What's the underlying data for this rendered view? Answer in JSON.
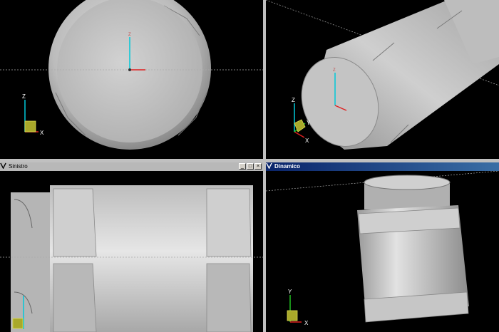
{
  "viewports": {
    "top_left": {
      "name": ""
    },
    "top_right": {
      "name": ""
    },
    "bottom_left": {
      "name": "Sinistro"
    },
    "bottom_right": {
      "name": "Dinamico"
    }
  },
  "axis_labels": {
    "x": "X",
    "y": "Y",
    "z": "Z"
  },
  "window_buttons": {
    "minimize": "_",
    "maximize": "□",
    "close": "×"
  },
  "colors": {
    "x_axis": "#e02020",
    "y_axis": "#20c020",
    "z_axis": "#00c8d8",
    "viewport_bg": "#000000",
    "active_title": "#0a246a"
  }
}
